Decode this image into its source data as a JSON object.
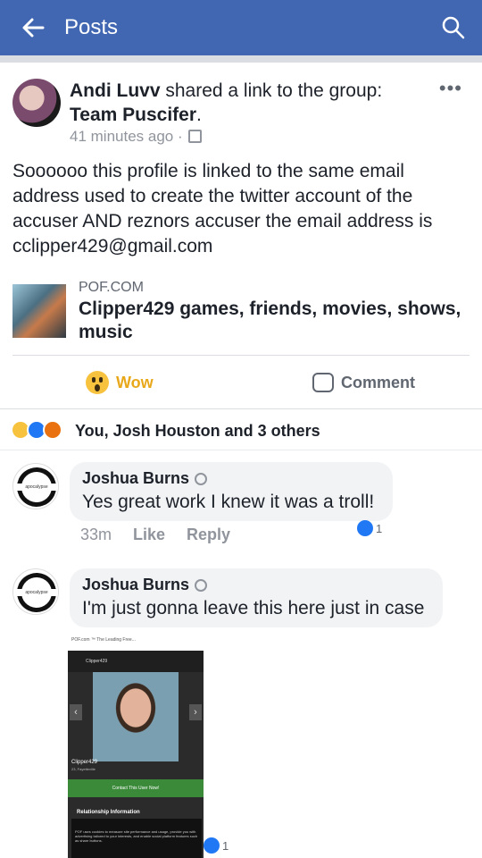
{
  "topbar": {
    "title": "Posts"
  },
  "post": {
    "author": "Andi Luvv",
    "action": " shared a link to the group:",
    "group": "Team Puscifer",
    "group_suffix": ".",
    "time": "41 minutes ago",
    "body": "Soooooo this profile is linked to the same email address used to create the twitter account of the accuser AND reznors accuser  the email address is cclipper429@gmail.com",
    "link": {
      "domain": "POF.COM",
      "title": "Clipper429 games, friends, movies, shows, music"
    }
  },
  "actions": {
    "wow_label": "Wow",
    "comment_label": "Comment"
  },
  "reactions_text": "You, Josh Houston and 3 others",
  "comments": [
    {
      "name": "Joshua Burns",
      "text": "Yes great work I knew it was a troll!",
      "time": "33m",
      "like": "Like",
      "reply": "Reply",
      "likes": "1"
    },
    {
      "name": "Joshua Burns",
      "text": "I'm just gonna leave this here just in case",
      "likes": "1"
    }
  ],
  "embedded": {
    "url": "POF.com ™ The Leading Free...",
    "nav": "Clipper429",
    "name": "Clipper429",
    "sub": "23, Fayetteville",
    "button": "Contact This User Now!",
    "section": "Relationship Information",
    "cookie": "POF uses cookies to measure site performance and usage, provide you with advertising tailored to your interests, and enable social platform features such as share buttons."
  },
  "colors": {
    "brand": "#4267b2",
    "wow": "#f7c23e",
    "like": "#2078f4"
  }
}
